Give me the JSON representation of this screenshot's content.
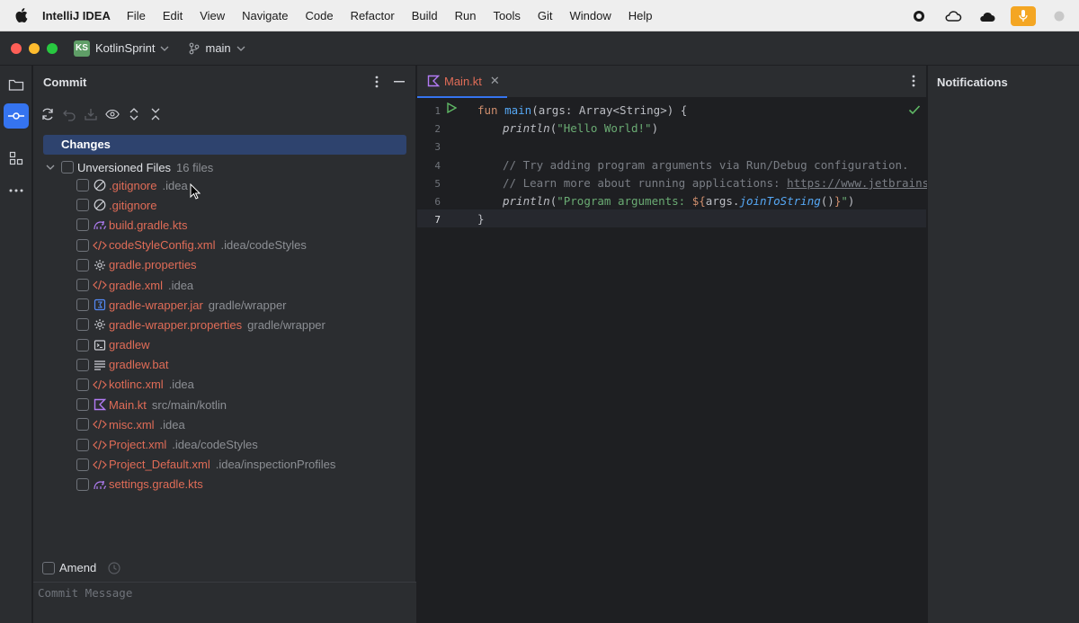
{
  "menubar": {
    "app_name": "IntelliJ IDEA",
    "items": [
      "File",
      "Edit",
      "View",
      "Navigate",
      "Code",
      "Refactor",
      "Build",
      "Run",
      "Tools",
      "Git",
      "Window",
      "Help"
    ]
  },
  "titlebar": {
    "project_badge": "KS",
    "project_name": "KotlinSprint",
    "branch": "main"
  },
  "commit_panel": {
    "title": "Commit",
    "changes_label": "Changes",
    "group_label": "Unversioned Files",
    "group_count": "16 files",
    "files": [
      {
        "name": ".gitignore",
        "path": ".idea",
        "icon": "ignore-icon"
      },
      {
        "name": ".gitignore",
        "path": "",
        "icon": "ignore-icon"
      },
      {
        "name": "build.gradle.kts",
        "path": "",
        "icon": "gradle-icon"
      },
      {
        "name": "codeStyleConfig.xml",
        "path": ".idea/codeStyles",
        "icon": "xml-icon"
      },
      {
        "name": "gradle.properties",
        "path": "",
        "icon": "properties-icon"
      },
      {
        "name": "gradle.xml",
        "path": ".idea",
        "icon": "xml-icon"
      },
      {
        "name": "gradle-wrapper.jar",
        "path": "gradle/wrapper",
        "icon": "jar-icon"
      },
      {
        "name": "gradle-wrapper.properties",
        "path": "gradle/wrapper",
        "icon": "properties-icon"
      },
      {
        "name": "gradlew",
        "path": "",
        "icon": "shell-icon"
      },
      {
        "name": "gradlew.bat",
        "path": "",
        "icon": "text-icon"
      },
      {
        "name": "kotlinc.xml",
        "path": ".idea",
        "icon": "xml-icon"
      },
      {
        "name": "Main.kt",
        "path": "src/main/kotlin",
        "icon": "kotlin-icon"
      },
      {
        "name": "misc.xml",
        "path": ".idea",
        "icon": "xml-icon"
      },
      {
        "name": "Project.xml",
        "path": ".idea/codeStyles",
        "icon": "xml-icon"
      },
      {
        "name": "Project_Default.xml",
        "path": ".idea/inspectionProfiles",
        "icon": "xml-icon"
      },
      {
        "name": "settings.gradle.kts",
        "path": "",
        "icon": "gradle-icon"
      }
    ],
    "amend_label": "Amend",
    "commit_message_placeholder": "Commit Message"
  },
  "editor": {
    "tab_label": "Main.kt",
    "line_numbers": [
      "1",
      "2",
      "3",
      "4",
      "5",
      "6",
      "7"
    ],
    "code": {
      "l1_kw": "fun ",
      "l1_fn": "main",
      "l1_rest": "(args: Array<String>) {",
      "l2_call": "println",
      "l2_open": "(",
      "l2_str": "\"Hello World!\"",
      "l2_close": ")",
      "l4_comment": "// Try adding program arguments via Run/Debug configuration.",
      "l5_comment": "// Learn more about running applications: ",
      "l5_link": "https://www.jetbrains.co",
      "l6_call": "println",
      "l6_open": "(",
      "l6_str1": "\"Program arguments: ",
      "l6_tpl_open": "${",
      "l6_args": "args.",
      "l6_fn": "joinToString",
      "l6_paren": "()",
      "l6_tpl_close": "}",
      "l6_str2": "\"",
      "l6_close": ")",
      "l7": "}"
    }
  },
  "notifications": {
    "title": "Notifications"
  },
  "colors": {
    "accent": "#3574f0",
    "unversioned_file": "#e06c57",
    "selection": "#2e436e"
  }
}
